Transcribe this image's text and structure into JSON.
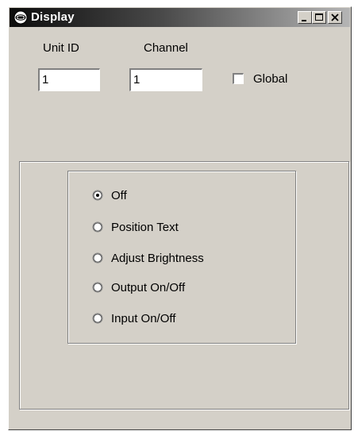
{
  "window": {
    "title": "Display",
    "icon": "display-app-icon",
    "controls": [
      "minimize-icon",
      "maximize-icon",
      "close-icon"
    ]
  },
  "fields": {
    "unit_id": {
      "label": "Unit ID",
      "value": "1"
    },
    "channel": {
      "label": "Channel",
      "value": "1"
    },
    "global": {
      "label": "Global",
      "checked": false
    }
  },
  "mode": {
    "options": [
      {
        "label": "Off",
        "selected": true
      },
      {
        "label": "Position Text",
        "selected": false
      },
      {
        "label": "Adjust Brightness",
        "selected": false
      },
      {
        "label": "Output On/Off",
        "selected": false
      },
      {
        "label": "Input On/Off",
        "selected": false
      }
    ]
  }
}
